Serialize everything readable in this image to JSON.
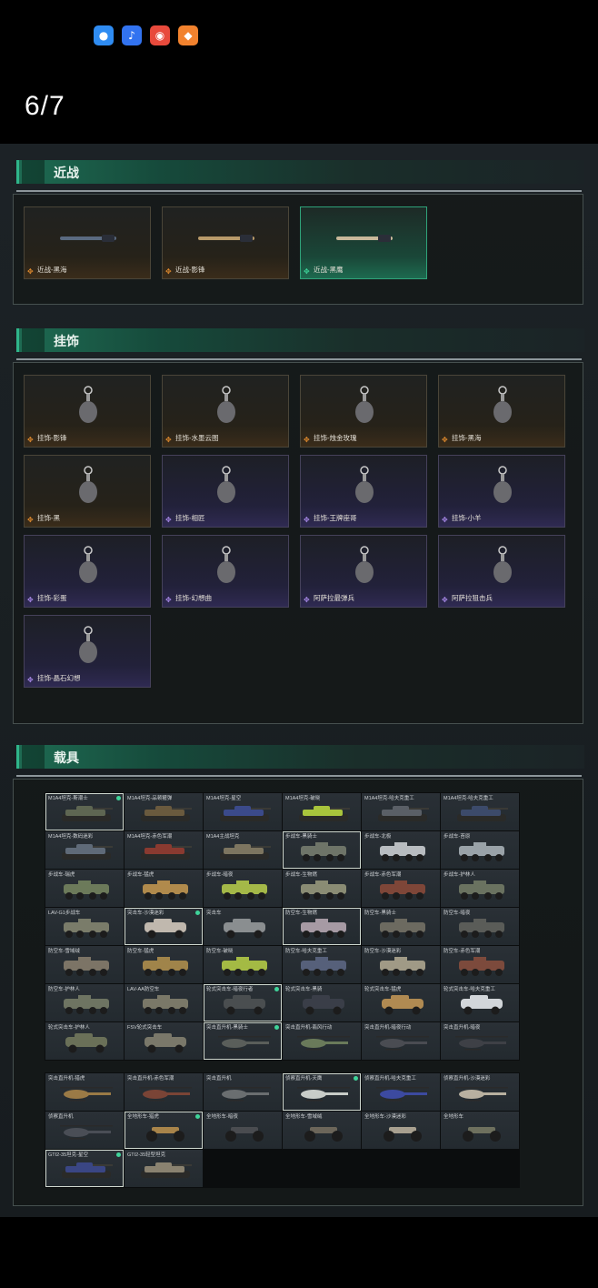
{
  "status_bar": {
    "icons": [
      {
        "name": "message-app-icon",
        "color": "#2f8cf2",
        "glyph": "💬"
      },
      {
        "name": "voice-app-icon",
        "color": "#3273f0",
        "glyph": "♪"
      },
      {
        "name": "panda-app-icon",
        "color": "#e84a3c",
        "glyph": "◉"
      },
      {
        "name": "fox-app-icon",
        "color": "#f2822e",
        "glyph": "◆"
      }
    ]
  },
  "page_counter": "6/7",
  "sections": {
    "melee": {
      "title": "近战",
      "items": [
        {
          "label": "近战-黑海",
          "rarity": "orange"
        },
        {
          "label": "近战-影锋",
          "rarity": "orange"
        },
        {
          "label": "近战-黑鹰",
          "rarity": "green"
        }
      ]
    },
    "charms": {
      "title": "挂饰",
      "items": [
        {
          "label": "挂饰-影锋",
          "rarity": "orange"
        },
        {
          "label": "挂饰-水墨云图",
          "rarity": "orange"
        },
        {
          "label": "挂饰-烛金玫瑰",
          "rarity": "orange"
        },
        {
          "label": "挂饰-黑海",
          "rarity": "orange"
        },
        {
          "label": "挂饰-黑",
          "rarity": "orange"
        },
        {
          "label": "挂饰-相匠",
          "rarity": "purple"
        },
        {
          "label": "挂饰-王牌座哥",
          "rarity": "purple"
        },
        {
          "label": "挂饰-小羊",
          "rarity": "purple"
        },
        {
          "label": "挂饰-彩蛋",
          "rarity": "purple"
        },
        {
          "label": "挂饰-幻想曲",
          "rarity": "purple"
        },
        {
          "label": "阿萨拉最弹兵",
          "rarity": "purple"
        },
        {
          "label": "阿萨拉狙击兵",
          "rarity": "purple"
        },
        {
          "label": "挂饰-晶石幻想",
          "rarity": "purple"
        }
      ]
    },
    "vehicles": {
      "title": "载具",
      "grid1": [
        {
          "label": "M1A4坦克-斯潮士",
          "kind": "tank",
          "selected": true,
          "dot": true,
          "color": "#5e6652"
        },
        {
          "label": "M1A4坦克-品顿獾弹",
          "kind": "tank",
          "color": "#6a5a3e"
        },
        {
          "label": "M1A4坦克-星空",
          "kind": "tank",
          "color": "#3b4a8a"
        },
        {
          "label": "M1A4坦克-破晓",
          "kind": "tank",
          "color": "#a8c43c"
        },
        {
          "label": "M1A4坦克-哈夫克重工",
          "kind": "tank",
          "color": "#5a5f66"
        },
        {
          "label": "M1A4坦克-哈夫克重工",
          "kind": "tank",
          "color": "#3c4a6a"
        },
        {
          "label": "M1A4坦克-数码迷彩",
          "kind": "tank",
          "color": "#5f6a78"
        },
        {
          "label": "M1A4坦克-赤色军潮",
          "kind": "tank",
          "color": "#8a3a30"
        },
        {
          "label": "M1A4主战坦克",
          "kind": "tank",
          "color": "#7d7560"
        },
        {
          "label": "步战车-黑骑士",
          "kind": "apc",
          "selected": true,
          "color": "#6e7468"
        },
        {
          "label": "步战车-北极",
          "kind": "apc",
          "color": "#b8bcc0"
        },
        {
          "label": "步战车-苔原",
          "kind": "apc",
          "color": "#9aa2a8"
        },
        {
          "label": "步战车-瑞虎",
          "kind": "apc",
          "color": "#6c7a5a"
        },
        {
          "label": "步战车-猛虎",
          "kind": "apc",
          "color": "#b08a4c"
        },
        {
          "label": "步战车-暗夜",
          "kind": "apc",
          "color": "#a4b848"
        },
        {
          "label": "步战车-生物燃",
          "kind": "apc",
          "color": "#8a8c74"
        },
        {
          "label": "步战车-赤色军潮",
          "kind": "apc",
          "color": "#7e4638"
        },
        {
          "label": "步战车-护林人",
          "kind": "apc",
          "color": "#6a7260"
        },
        {
          "label": "LAV-G1步战车",
          "kind": "apc",
          "color": "#7a7c6a"
        },
        {
          "label": "突击车-沙漠迷彩",
          "kind": "car",
          "selected": true,
          "dot": true,
          "color": "#c0b8ae"
        },
        {
          "label": "突击车",
          "kind": "car",
          "color": "#8a8e90"
        },
        {
          "label": "防空车-生物燃",
          "kind": "apc",
          "selected": true,
          "color": "#a69aa4"
        },
        {
          "label": "防空车-黑骑士",
          "kind": "apc",
          "color": "#6c6a60"
        },
        {
          "label": "防空车-暗夜",
          "kind": "apc",
          "color": "#5a5c58"
        },
        {
          "label": "防空车-雪域绒",
          "kind": "apc",
          "color": "#7c7466"
        },
        {
          "label": "防空车-猛虎",
          "kind": "apc",
          "color": "#a0844a"
        },
        {
          "label": "防空车-破晓",
          "kind": "apc",
          "color": "#a4ba44"
        },
        {
          "label": "防空车-哈夫克重工",
          "kind": "apc",
          "color": "#56607a"
        },
        {
          "label": "防空车-沙漠迷彩",
          "kind": "apc",
          "color": "#a09a86"
        },
        {
          "label": "防空车-赤色军潮",
          "kind": "apc",
          "color": "#7c4a3c"
        },
        {
          "label": "防空车-护林人",
          "kind": "apc",
          "color": "#6e7462"
        },
        {
          "label": "LAV-AA防空车",
          "kind": "apc",
          "color": "#7a7868"
        },
        {
          "label": "轮式突击车-暗夜行者",
          "kind": "car",
          "selected": true,
          "dot": true,
          "color": "#4a4e50"
        },
        {
          "label": "轮式突击车-黑骑",
          "kind": "car",
          "color": "#3a3e48"
        },
        {
          "label": "轮式突击车-猛虎",
          "kind": "car",
          "color": "#b08a52"
        },
        {
          "label": "轮式突击车-哈夫克重工",
          "kind": "car",
          "color": "#d2d6da"
        },
        {
          "label": "轮式突击车-护林人",
          "kind": "car",
          "color": "#6a7058"
        },
        {
          "label": "FSV轮式突击车",
          "kind": "car",
          "color": "#7a786a"
        },
        {
          "label": "突击直升机-黑骑士",
          "kind": "heli",
          "selected": true,
          "dot": true,
          "color": "#5a5e5a"
        },
        {
          "label": "突击直升机-翡风行动",
          "kind": "heli",
          "color": "#6a7a5a"
        },
        {
          "label": "突击直升机-暗夜行动",
          "kind": "heli",
          "color": "#4a4c52"
        },
        {
          "label": "突击直升机-暗夜",
          "kind": "heli",
          "color": "#3e4046"
        }
      ],
      "grid2": [
        {
          "label": "突击直升机-猎虎",
          "kind": "heli",
          "color": "#9a7a46"
        },
        {
          "label": "突击直升机-赤色军潮",
          "kind": "heli",
          "color": "#7a4436"
        },
        {
          "label": "突击直升机",
          "kind": "heli",
          "color": "#6a6e70"
        },
        {
          "label": "侦察直升机-天鹰",
          "kind": "heli",
          "selected": true,
          "dot": true,
          "color": "#c8ccc8"
        },
        {
          "label": "侦察直升机-哈夫克重工",
          "kind": "heli",
          "color": "#3c4aa0"
        },
        {
          "label": "侦察直升机-沙漠迷彩",
          "kind": "heli",
          "color": "#b8b0a0"
        },
        {
          "label": "侦察直升机",
          "kind": "heli",
          "color": "#4a4e56"
        },
        {
          "label": "全地形车-猎虎",
          "kind": "atv",
          "selected": true,
          "dot": true,
          "color": "#a8844a"
        },
        {
          "label": "全地形车-暗夜",
          "kind": "atv",
          "color": "#4a4c50"
        },
        {
          "label": "全地形车-雪域绒",
          "kind": "atv",
          "color": "#6c665a"
        },
        {
          "label": "全地形车-沙漠迷彩",
          "kind": "atv",
          "color": "#a8a090"
        },
        {
          "label": "全地形车",
          "kind": "atv",
          "color": "#6e705e"
        },
        {
          "label": "GTI2-35坦克-星空",
          "kind": "tank",
          "selected": true,
          "dot": true,
          "color": "#3a4684"
        },
        {
          "label": "GTI2-35轻型坦克",
          "kind": "tank",
          "color": "#8a8270"
        },
        {
          "label": "",
          "kind": "empty"
        },
        {
          "label": "",
          "kind": "empty"
        },
        {
          "label": "",
          "kind": "empty"
        },
        {
          "label": "",
          "kind": "empty"
        }
      ]
    }
  },
  "colors": {
    "accent_green": "#2fb58a",
    "rarity_orange": "#e08a2e",
    "rarity_purple": "#a889e8",
    "rarity_green": "#3fd49a"
  }
}
